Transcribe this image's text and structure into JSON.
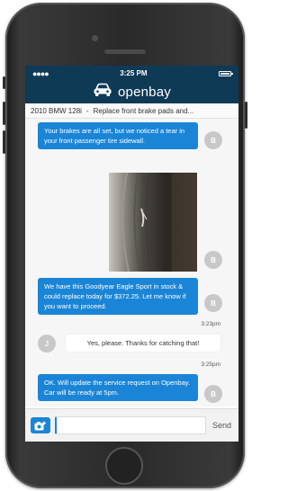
{
  "status": {
    "time": "3:25 PM"
  },
  "app": {
    "brand": "openbay"
  },
  "subject": {
    "vehicle": "2010 BMW 128i",
    "separator": "-",
    "service": "Replace front brake pads and..."
  },
  "messages": [
    {
      "text": "Your brakes are all set, but we noticed a tear in your front passenger tire sidewall.",
      "avatar": "B"
    },
    {
      "photo": "tire-sidewall-photo",
      "avatar": "B"
    },
    {
      "text": "We have this Goodyear Eagle Sport in stock & could replace today for $372.25. Let me know if you want to proceed.",
      "avatar": "B",
      "time": "3:23pm"
    },
    {
      "text": "Yes, please. Thanks for catching that!",
      "avatar": "J",
      "time": "3:25pm"
    },
    {
      "text": "OK. Will update the service request on Openbay. Car will be ready at 5pm.",
      "avatar": "B"
    }
  ],
  "composer": {
    "value": "",
    "send_label": "Send"
  },
  "colors": {
    "header": "#0f3a56",
    "accent": "#1a85d6"
  },
  "icons": {
    "signal": "signal-dots-icon",
    "battery": "battery-icon",
    "car": "car-icon",
    "camera": "camera-plus-icon"
  }
}
